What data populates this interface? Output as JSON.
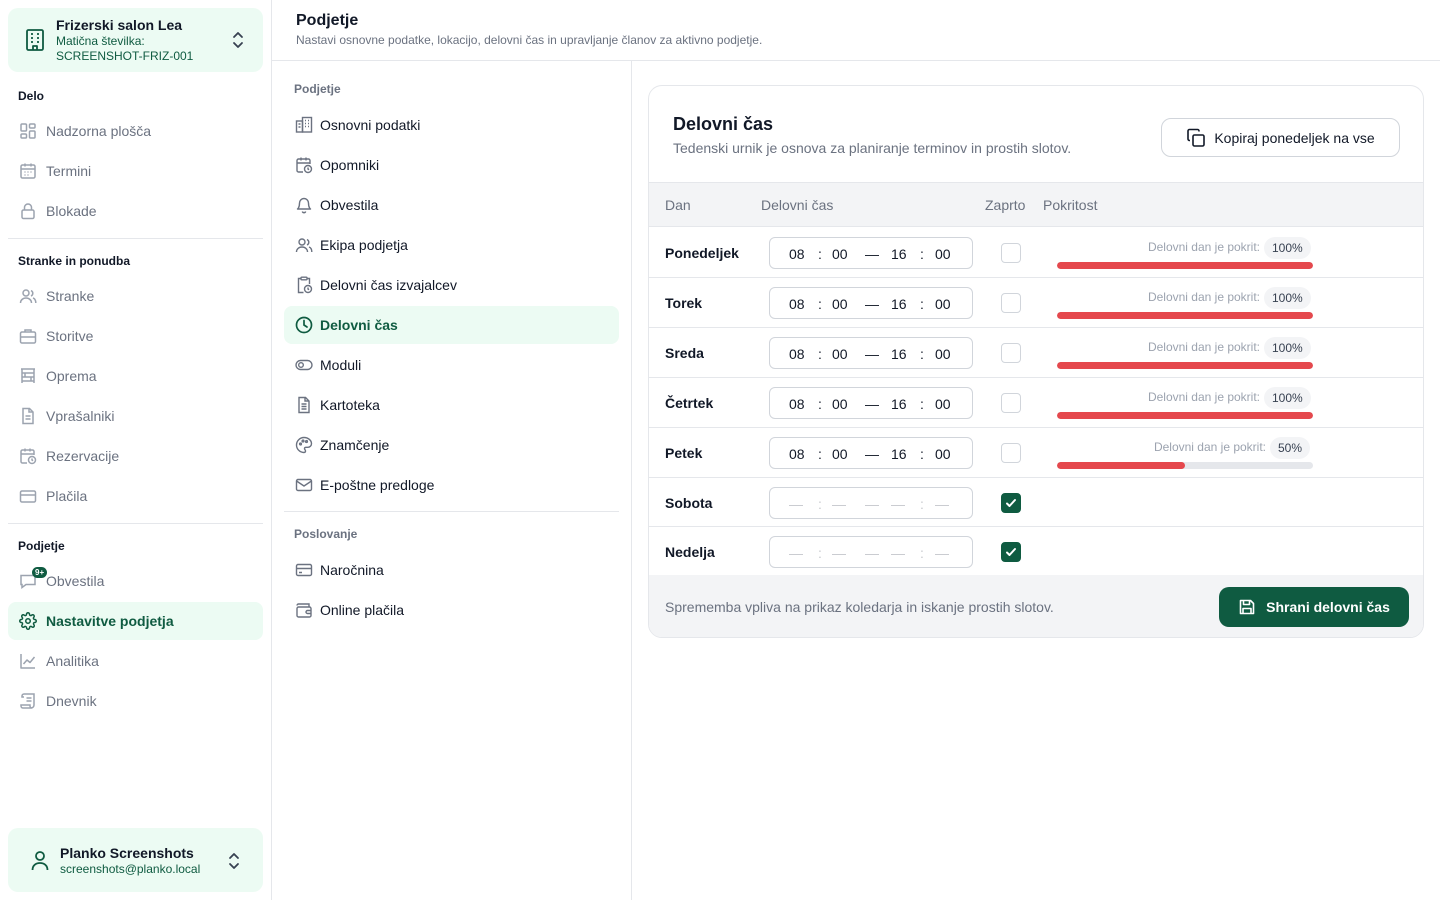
{
  "colors": {
    "accent": "#0f5b41",
    "accent_bg": "#ecfbf3",
    "danger_bar": "#e5484d"
  },
  "org": {
    "name": "Frizerski salon Lea",
    "id_label": "Matična številka:",
    "id_value": "SCREENSHOT-FRIZ-001",
    "icon": "building-icon"
  },
  "sidebar": {
    "sections": [
      {
        "title": "Delo",
        "items": [
          {
            "label": "Nadzorna plošča",
            "icon": "dashboard-icon"
          },
          {
            "label": "Termini",
            "icon": "calendar-icon"
          },
          {
            "label": "Blokade",
            "icon": "lock-icon"
          }
        ]
      },
      {
        "title": "Stranke in ponudba",
        "items": [
          {
            "label": "Stranke",
            "icon": "users-icon"
          },
          {
            "label": "Storitve",
            "icon": "briefcase-icon"
          },
          {
            "label": "Oprema",
            "icon": "equipment-icon"
          },
          {
            "label": "Vprašalniki",
            "icon": "document-icon"
          },
          {
            "label": "Rezervacije",
            "icon": "calendar-clock-icon"
          },
          {
            "label": "Plačila",
            "icon": "wallet-icon"
          }
        ]
      },
      {
        "title": "Podjetje",
        "items": [
          {
            "label": "Obvestila",
            "icon": "message-icon",
            "badge": "9+"
          },
          {
            "label": "Nastavitve podjetja",
            "icon": "gear-icon",
            "active": true
          },
          {
            "label": "Analitika",
            "icon": "chart-icon"
          },
          {
            "label": "Dnevnik",
            "icon": "scroll-icon"
          }
        ]
      }
    ]
  },
  "user": {
    "name": "Planko Screenshots",
    "email": "screenshots@planko.local",
    "icon": "user-icon"
  },
  "header": {
    "title": "Podjetje",
    "subtitle": "Nastavi osnovne podatke, lokacijo, delovni čas in upravljanje članov za aktivno podjetje."
  },
  "settings_nav": {
    "company_title": "Podjetje",
    "company_items": [
      {
        "label": "Osnovni podatki",
        "icon": "building-icon"
      },
      {
        "label": "Opomniki",
        "icon": "calendar-clock-icon"
      },
      {
        "label": "Obvestila",
        "icon": "bell-icon"
      },
      {
        "label": "Ekipa podjetja",
        "icon": "users-icon"
      },
      {
        "label": "Delovni čas izvajalcev",
        "icon": "clipboard-clock-icon"
      },
      {
        "label": "Delovni čas",
        "icon": "clock-icon",
        "active": true
      },
      {
        "label": "Moduli",
        "icon": "toggle-icon"
      },
      {
        "label": "Kartoteka",
        "icon": "file-icon"
      },
      {
        "label": "Znamčenje",
        "icon": "palette-icon"
      },
      {
        "label": "E-poštne predloge",
        "icon": "mail-icon"
      }
    ],
    "business_title": "Poslovanje",
    "business_items": [
      {
        "label": "Naročnina",
        "icon": "credit-card-icon"
      },
      {
        "label": "Online plačila",
        "icon": "wallet-icon"
      }
    ]
  },
  "card": {
    "title": "Delovni čas",
    "description": "Tedenski urnik je osnova za planiranje terminov in prostih slotov.",
    "copy_button": "Kopiraj ponedeljek na vse",
    "copy_icon": "copy-icon",
    "columns": {
      "day": "Dan",
      "hours": "Delovni čas",
      "closed": "Zaprto",
      "coverage": "Pokritost"
    },
    "coverage_label": "Delovni dan je pokrit:",
    "rows": [
      {
        "day": "Ponedeljek",
        "from_h": "08",
        "from_m": "00",
        "to_h": "16",
        "to_m": "00",
        "closed": false,
        "coverage": "100%",
        "coverage_value": 1.0
      },
      {
        "day": "Torek",
        "from_h": "08",
        "from_m": "00",
        "to_h": "16",
        "to_m": "00",
        "closed": false,
        "coverage": "100%",
        "coverage_value": 1.0
      },
      {
        "day": "Sreda",
        "from_h": "08",
        "from_m": "00",
        "to_h": "16",
        "to_m": "00",
        "closed": false,
        "coverage": "100%",
        "coverage_value": 1.0
      },
      {
        "day": "Četrtek",
        "from_h": "08",
        "from_m": "00",
        "to_h": "16",
        "to_m": "00",
        "closed": false,
        "coverage": "100%",
        "coverage_value": 1.0
      },
      {
        "day": "Petek",
        "from_h": "08",
        "from_m": "00",
        "to_h": "16",
        "to_m": "00",
        "closed": false,
        "coverage": "50%",
        "coverage_value": 0.5
      },
      {
        "day": "Sobota",
        "from_h": "—",
        "from_m": "—",
        "to_h": "—",
        "to_m": "—",
        "closed": true
      },
      {
        "day": "Nedelja",
        "from_h": "—",
        "from_m": "—",
        "to_h": "—",
        "to_m": "—",
        "closed": true
      }
    ],
    "footer_note": "Sprememba vpliva na prikaz koledarja in iskanje prostih slotov.",
    "save_button": "Shrani delovni čas",
    "save_icon": "save-icon"
  }
}
